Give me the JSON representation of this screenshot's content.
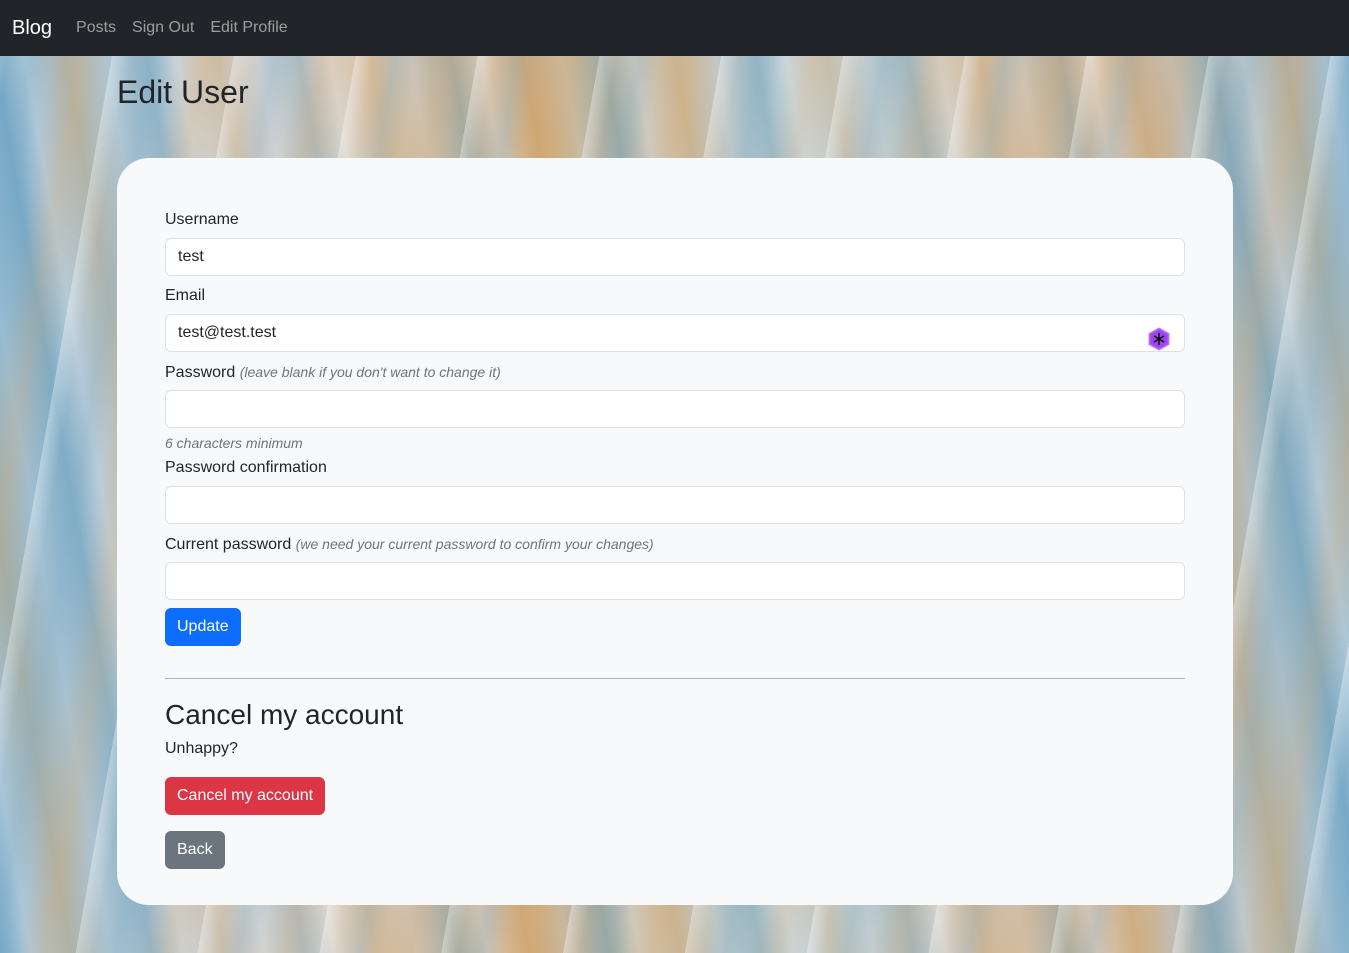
{
  "nav": {
    "brand": "Blog",
    "links": [
      "Posts",
      "Sign Out",
      "Edit Profile"
    ]
  },
  "page": {
    "title": "Edit User"
  },
  "form": {
    "username": {
      "label": "Username",
      "value": "test"
    },
    "email": {
      "label": "Email",
      "value": "test@test.test"
    },
    "password": {
      "label": "Password",
      "note": "(leave blank if you don't want to change it)",
      "value": "",
      "hint": "6 characters minimum"
    },
    "password_confirmation": {
      "label": "Password confirmation",
      "value": ""
    },
    "current_password": {
      "label": "Current password",
      "note": "(we need your current password to confirm your changes)",
      "value": ""
    },
    "submit_label": "Update"
  },
  "cancel": {
    "title": "Cancel my account",
    "text": "Unhappy?",
    "button_label": "Cancel my account"
  },
  "back_label": "Back",
  "colors": {
    "navbar": "#212529",
    "primary": "#0d6efd",
    "danger": "#dc3545",
    "secondary": "#6c757d",
    "card": "#f8f9fa"
  },
  "icons": {
    "email_extension": "password-manager-icon"
  }
}
